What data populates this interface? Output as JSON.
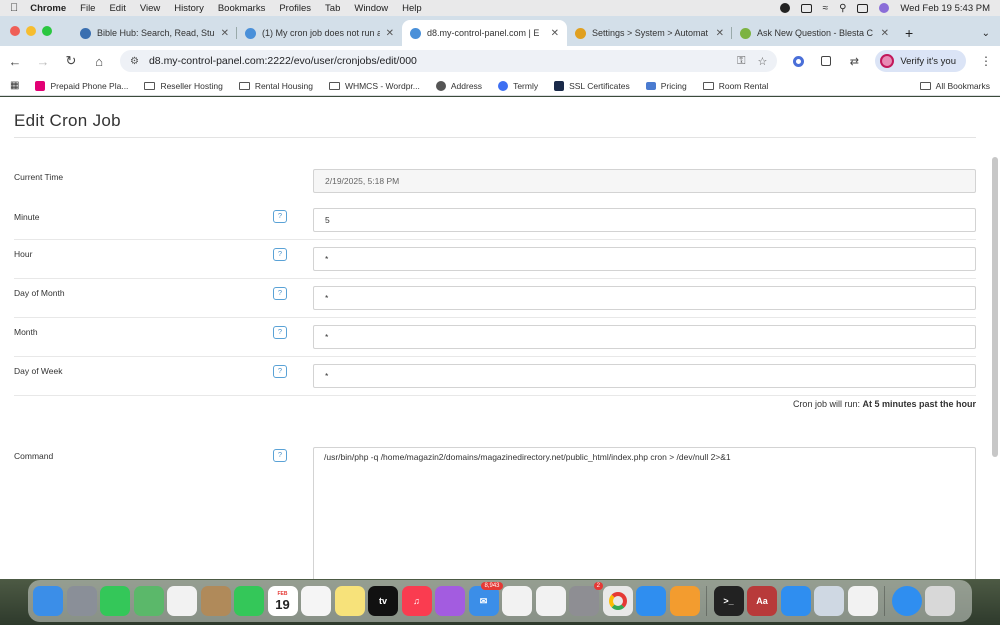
{
  "menubar": {
    "app_name": "Chrome",
    "items": [
      "File",
      "Edit",
      "View",
      "History",
      "Bookmarks",
      "Profiles",
      "Tab",
      "Window",
      "Help"
    ],
    "datetime": "Wed Feb 19  5:43 PM"
  },
  "tabs": [
    {
      "title": "Bible Hub: Search, Read, Stu",
      "color": "#3a6fb0",
      "active": false
    },
    {
      "title": "(1) My cron job does not run a",
      "color": "#4a90d9",
      "active": false
    },
    {
      "title": "d8.my-control-panel.com | E",
      "color": "#4a90d9",
      "active": true
    },
    {
      "title": "Settings > System > Automat",
      "color": "#e0a020",
      "active": false
    },
    {
      "title": "Ask New Question - Blesta C",
      "color": "#7cb342",
      "active": false
    }
  ],
  "toolbar": {
    "url": "d8.my-control-panel.com:2222/evo/user/cronjobs/edit/000",
    "verify_label": "Verify it's you"
  },
  "bookmarks": [
    {
      "label": "Prepaid Phone Pla...",
      "icon": "tmobile",
      "color": "#e20074"
    },
    {
      "label": "Reseller Hosting",
      "icon": "folder"
    },
    {
      "label": "Rental Housing",
      "icon": "folder"
    },
    {
      "label": "WHMCS - Wordpr...",
      "icon": "folder"
    },
    {
      "label": "Address",
      "icon": "globe",
      "color": "#555555"
    },
    {
      "label": "Termly",
      "icon": "termly",
      "color": "#3d6ff2"
    },
    {
      "label": "SSL Certificates",
      "icon": "ssl",
      "color": "#1a2a4a"
    },
    {
      "label": "Pricing",
      "icon": "lines",
      "color": "#4a7bd0"
    },
    {
      "label": "Room Rental",
      "icon": "folder"
    }
  ],
  "all_bookmarks": "All Bookmarks",
  "page": {
    "title": "Edit Cron Job",
    "fields": [
      {
        "label": "Current Time",
        "value": "2/19/2025, 5:18 PM",
        "readonly": true,
        "help": false
      },
      {
        "label": "Minute",
        "value": "5",
        "readonly": false,
        "help": true
      },
      {
        "label": "Hour",
        "value": "*",
        "readonly": false,
        "help": true
      },
      {
        "label": "Day of Month",
        "value": "*",
        "readonly": false,
        "help": true
      },
      {
        "label": "Month",
        "value": "*",
        "readonly": false,
        "help": true
      },
      {
        "label": "Day of Week",
        "value": "*",
        "readonly": false,
        "help": true
      }
    ],
    "help_glyph": "?",
    "summary_prefix": "Cron job will run:",
    "summary_value": "At 5 minutes past the hour",
    "command_label": "Command",
    "command_value": "/usr/bin/php -q /home/magazin2/domains/magazinedirectory.net/public_html/index.php cron > /dev/null 2>&1"
  },
  "dock": {
    "apps": [
      {
        "name": "finder",
        "color": "#3b8ee8"
      },
      {
        "name": "launchpad",
        "color": "#8a8f98"
      },
      {
        "name": "messages",
        "color": "#34c759"
      },
      {
        "name": "maps",
        "color": "#5bb86a"
      },
      {
        "name": "photos",
        "color": "#f2f2f2"
      },
      {
        "name": "contacts",
        "color": "#b08a5a"
      },
      {
        "name": "facetime",
        "color": "#34c759"
      },
      {
        "name": "calendar",
        "color": "#ffffff",
        "month": "FEB",
        "day": "19"
      },
      {
        "name": "reminders",
        "color": "#f5f5f5"
      },
      {
        "name": "notes",
        "color": "#f7e27a"
      },
      {
        "name": "tv",
        "color": "#111111",
        "text": "tv"
      },
      {
        "name": "music",
        "color": "#fa3c50"
      },
      {
        "name": "podcasts",
        "color": "#a35ce0"
      },
      {
        "name": "mail",
        "color": "#3b8ee8",
        "badge": "8,943"
      },
      {
        "name": "freeform",
        "color": "#f2f2f2"
      },
      {
        "name": "news",
        "color": "#f2f2f2"
      },
      {
        "name": "system-settings",
        "color": "#8e8e93",
        "badge": "2"
      },
      {
        "name": "chrome",
        "color": "#e8e8e8"
      },
      {
        "name": "app-store",
        "color": "#2f8ef0"
      },
      {
        "name": "pages",
        "color": "#f39c2f"
      }
    ],
    "apps_right": [
      {
        "name": "terminal",
        "color": "#222222"
      },
      {
        "name": "dictionary",
        "color": "#b83a3a",
        "text": "Aa"
      },
      {
        "name": "safari",
        "color": "#2f8ef0"
      },
      {
        "name": "preview",
        "color": "#cfd8e3"
      },
      {
        "name": "java",
        "color": "#f2f2f2"
      }
    ],
    "apps_end": [
      {
        "name": "globe",
        "color": "#2f8ef0"
      },
      {
        "name": "trash",
        "color": "#d8d8d8"
      }
    ]
  }
}
